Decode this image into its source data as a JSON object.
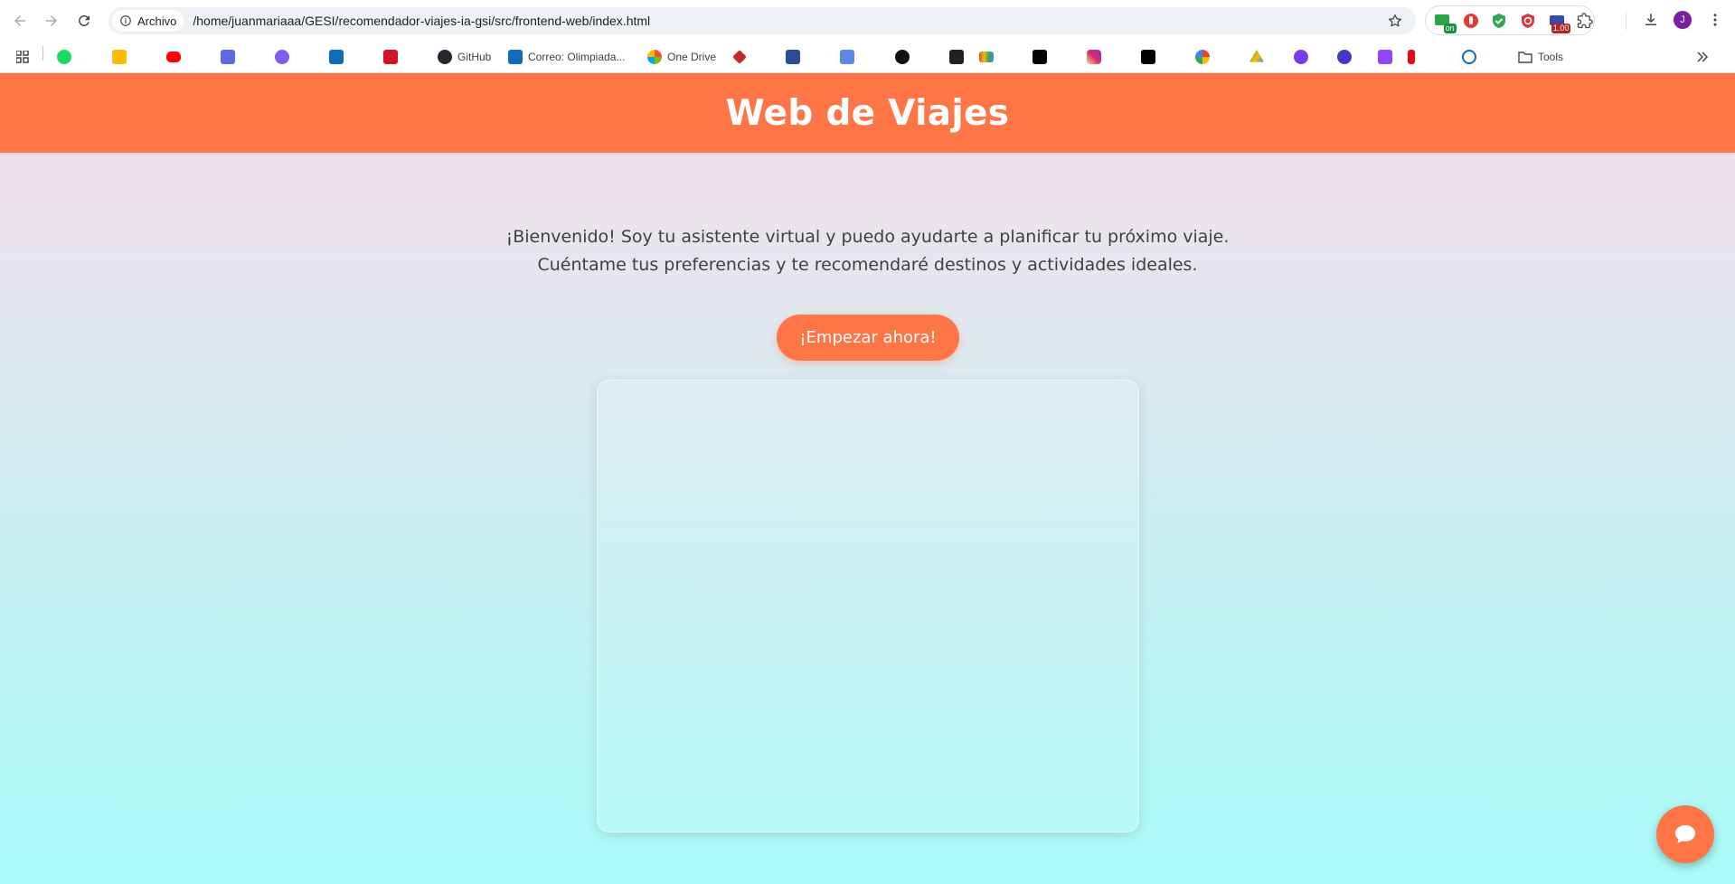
{
  "browser": {
    "site_chip_label": "Archivo",
    "url": "/home/juanmariaaa/GESI/recomendador-viajes-ia-gsi/src/frontend-web/index.html",
    "extension_badges": {
      "ext1": "on",
      "ext5": "1.00"
    },
    "avatar_initial": "J",
    "icons": [
      "back-icon",
      "forward-icon",
      "reload-icon",
      "info-icon",
      "star-icon",
      "extensions-icon",
      "download-icon",
      "menu-icon"
    ]
  },
  "bookmarks": {
    "items": [
      {
        "label": "GitHub"
      },
      {
        "label": "Correo: Olimpiada..."
      },
      {
        "label": "One Drive"
      },
      {
        "label": "Tools"
      }
    ]
  },
  "page": {
    "header_title": "Web de Viajes",
    "intro_line1": "¡Bienvenido! Soy tu asistente virtual y puedo ayudarte a planificar tu próximo viaje.",
    "intro_line2": "Cuéntame tus preferencias y te recomendaré destinos y actividades ideales.",
    "cta_label": "¡Empezar ahora!"
  },
  "colors": {
    "accent": "#fe7546",
    "gradient_top": "#f6dfea",
    "gradient_bottom": "#a9fcf9",
    "text": "#3f3f46"
  }
}
